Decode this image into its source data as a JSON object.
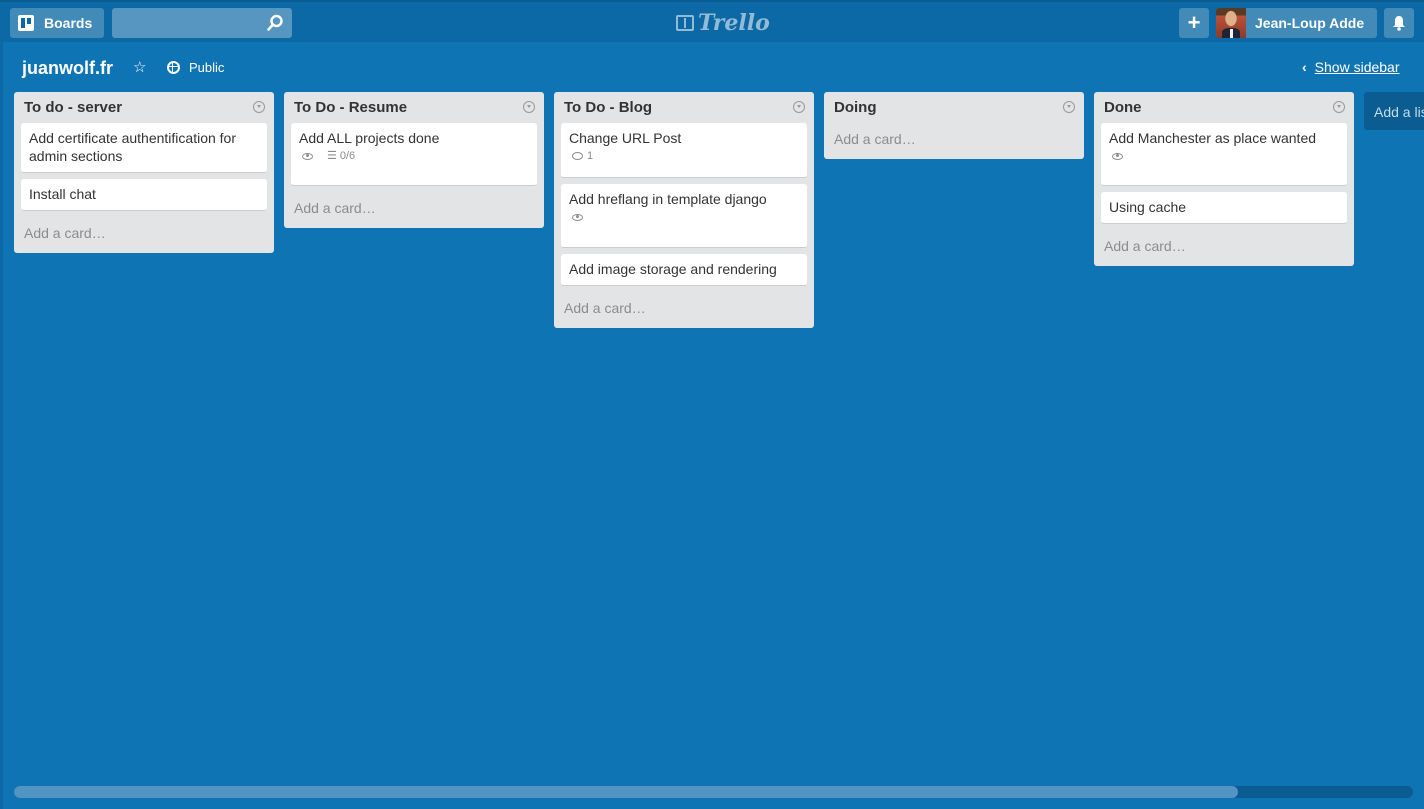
{
  "header": {
    "boards_label": "Boards",
    "search_value": "",
    "logo_text": "Trello",
    "plus_label": "+",
    "user_name": "Jean-Loup Adde"
  },
  "board": {
    "title": "juanwolf.fr",
    "visibility": "Public",
    "show_sidebar": "Show sidebar"
  },
  "lists": [
    {
      "title": "To do - server",
      "cards": [
        {
          "title": "Add certificate authentification for admin sections"
        },
        {
          "title": "Install chat"
        }
      ],
      "add_card": "Add a card…"
    },
    {
      "title": "To Do - Resume",
      "cards": [
        {
          "title": "Add ALL projects done",
          "checklist": "0/6"
        }
      ],
      "add_card": "Add a card…"
    },
    {
      "title": "To Do - Blog",
      "cards": [
        {
          "title": "Change URL Post",
          "comments": "1"
        },
        {
          "title": "Add hreflang in template django"
        },
        {
          "title": "Add image storage and rendering"
        }
      ],
      "add_card": "Add a card…"
    },
    {
      "title": "Doing",
      "cards": [],
      "add_card": "Add a card…"
    },
    {
      "title": "Done",
      "cards": [
        {
          "title": "Add Manchester as place wanted"
        },
        {
          "title": "Using cache"
        }
      ],
      "add_card": "Add a card…"
    }
  ],
  "add_list": "Add a list…",
  "colors": {
    "board_bg": "#0f74b3",
    "header_bg": "#0d69a5",
    "list_bg": "#e2e4e6"
  },
  "horizontal_scroll_fraction": 0.875
}
